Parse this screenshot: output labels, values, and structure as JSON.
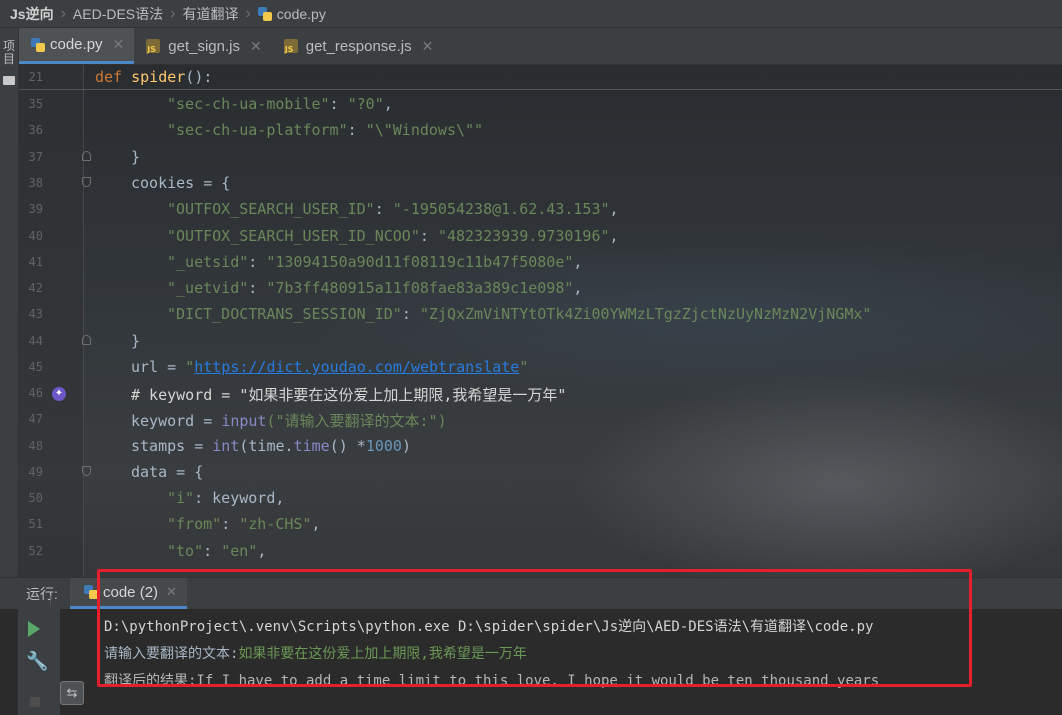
{
  "breadcrumb": {
    "items": [
      "Js逆向",
      "AED-DES语法",
      "有道翻译",
      "code.py"
    ]
  },
  "sidebar": {
    "project_label": "项目"
  },
  "tabs": [
    {
      "label": "code.py",
      "icon": "python-file-icon",
      "active": true
    },
    {
      "label": "get_sign.js",
      "icon": "js-file-icon",
      "active": false
    },
    {
      "label": "get_response.js",
      "icon": "js-file-icon",
      "active": false
    }
  ],
  "editor": {
    "sticky": {
      "line": "21",
      "def": "def",
      "name": "spider",
      "rest": "():"
    },
    "line_numbers": [
      "35",
      "36",
      "37",
      "38",
      "39",
      "40",
      "41",
      "42",
      "43",
      "44",
      "45",
      "46",
      "47",
      "48",
      "49",
      "50",
      "51",
      "52"
    ],
    "lines": {
      "l35_key": "\"sec-ch-ua-mobile\"",
      "l35_val": "\"?0\"",
      "l36_key": "\"sec-ch-ua-platform\"",
      "l36_val": "\"\\\"Windows\\\"\"",
      "l37": "}",
      "l38_a": "cookies = {",
      "l39_key": "\"OUTFOX_SEARCH_USER_ID\"",
      "l39_val": "\"-195054238@1.62.43.153\"",
      "l40_key": "\"OUTFOX_SEARCH_USER_ID_NCOO\"",
      "l40_val": "\"482323939.9730196\"",
      "l41_key": "\"_uetsid\"",
      "l41_val": "\"13094150a90d11f08119c11b47f5080e\"",
      "l42_key": "\"_uetvid\"",
      "l42_val": "\"7b3ff480915a11f08fae83a389c1e098\"",
      "l43_key": "\"DICT_DOCTRANS_SESSION_ID\"",
      "l43_val": "\"ZjQxZmViNTYtOTk4Zi00YWMzLTgzZjctNzUyNzMzN2VjNGMx\"",
      "l44": "}",
      "l45_a": "url = ",
      "l45_q1": "\"",
      "l45_url": "https://dict.youdao.com/webtranslate",
      "l45_q2": "\"",
      "l46": "# keyword = \"如果非要在这份爱上加上期限,我希望是一万年\"",
      "l47_a": "keyword = ",
      "l47_fn": "input",
      "l47_str": "(\"请输入要翻译的文本:\")",
      "l48_a": "stamps = ",
      "l48_int": "int",
      "l48_b": "(time.",
      "l48_time": "time",
      "l48_c": "() *",
      "l48_num": "1000",
      "l48_d": ")",
      "l49": "data = {",
      "l50_key": "\"i\"",
      "l50_val": ": keyword,",
      "l51_key": "\"from\"",
      "l51_val": "\"zh-CHS\"",
      "l52_key": "\"to\"",
      "l52_val": "\"en\""
    }
  },
  "run": {
    "label": "运行:",
    "tab_label": "code (2)",
    "console": {
      "command": "D:\\pythonProject\\.venv\\Scripts\\python.exe D:\\spider\\spider\\Js逆向\\AED-DES语法\\有道翻译\\code.py",
      "prompt": "请输入要翻译的文本:",
      "input": "如果非要在这份爱上加上期限,我希望是一万年",
      "result": "翻译后的结果:If I have to add a time limit to this love, I hope it would be ten thousand years"
    }
  }
}
